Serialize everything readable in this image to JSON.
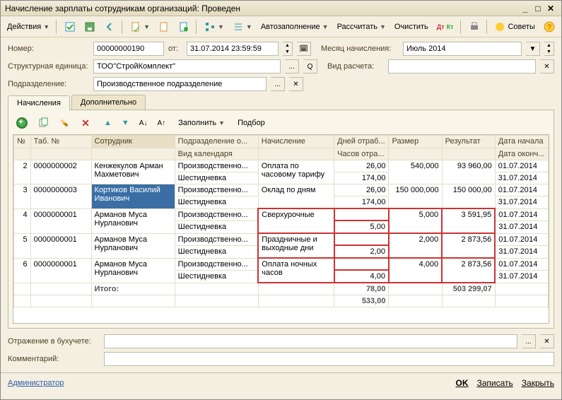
{
  "title": "Начисление зарплаты сотрудникам организаций: Проведен",
  "toolbar": {
    "actions": "Действия",
    "autofill": "Автозаполнение",
    "calc": "Рассчитать",
    "clear": "Очистить",
    "advice": "Советы"
  },
  "form": {
    "number_label": "Номер:",
    "number": "00000000190",
    "from_label": "от:",
    "date": "31.07.2014 23:59:59",
    "month_label": "Месяц начисления:",
    "month": "Июль 2014",
    "unit_label": "Структурная единица:",
    "unit": "ТОО\"СтройКомплект\"",
    "calc_type_label": "Вид расчета:",
    "division_label": "Подразделение:",
    "division": "Производственное подразделение"
  },
  "tabs": {
    "main": "Начисления",
    "extra": "Дополнительно"
  },
  "subtb": {
    "fill": "Заполнить",
    "select": "Подбор"
  },
  "headers": {
    "n": "№",
    "tab": "Таб. №",
    "emp": "Сотрудник",
    "div": "Подразделение о...",
    "cal": "Вид календаря",
    "accr": "Начисление",
    "days": "Дней отраб...",
    "hours": "Часов отра...",
    "size": "Размер",
    "result": "Результат",
    "start": "Дата начала",
    "end": "Дата оконч..."
  },
  "rows": [
    {
      "n": "2",
      "tab": "0000000002",
      "emp": "Кенжекулов Арман Махметович",
      "div": "Производственно...",
      "cal": "Шестидневка",
      "accr": "Оплата по часовому тарифу",
      "days": "26,00",
      "hours": "174,00",
      "size": "540,000",
      "res": "93 960,00",
      "d1": "01.07.2014",
      "d2": "31.07.2014"
    },
    {
      "n": "3",
      "tab": "0000000003",
      "emp": "Кортиков Василий Иванович",
      "div": "Производственно...",
      "cal": "Шестидневка",
      "accr": "Оклад по дням",
      "days": "26,00",
      "hours": "174,00",
      "size": "150 000,000",
      "res": "150 000,00",
      "d1": "01.07.2014",
      "d2": "31.07.2014",
      "sel": true
    },
    {
      "n": "4",
      "tab": "0000000001",
      "emp": "Арманов Муса Нурланович",
      "div": "Производственно...",
      "cal": "Шестидневка",
      "accr": "Сверхурочные",
      "days": "",
      "hours": "5,00",
      "size": "5,000",
      "res": "3 591,95",
      "d1": "01.07.2014",
      "d2": "31.07.2014",
      "hl": true
    },
    {
      "n": "5",
      "tab": "0000000001",
      "emp": "Арманов Муса Нурланович",
      "div": "Производственно...",
      "cal": "Шестидневка",
      "accr": "Праздничные и выходные дни",
      "days": "",
      "hours": "2,00",
      "size": "2,000",
      "res": "2 873,56",
      "d1": "01.07.2014",
      "d2": "31.07.2014",
      "hl": true
    },
    {
      "n": "6",
      "tab": "0000000001",
      "emp": "Арманов Муса Нурланович",
      "div": "Производственно...",
      "cal": "Шестидневка",
      "accr": "Оплата ночных часов",
      "days": "",
      "hours": "4,00",
      "size": "4,000",
      "res": "2 873,56",
      "d1": "01.07.2014",
      "d2": "31.07.2014",
      "hl": true
    }
  ],
  "totals": {
    "label": "Итого:",
    "days": "78,00",
    "hours": "533,00",
    "result": "503 299,07"
  },
  "footer": {
    "accounting_label": "Отражение в бухучете:",
    "comment_label": "Комментарий:",
    "admin": "Администратор"
  },
  "buttons": {
    "ok": "OK",
    "save": "Записать",
    "close": "Закрыть"
  }
}
